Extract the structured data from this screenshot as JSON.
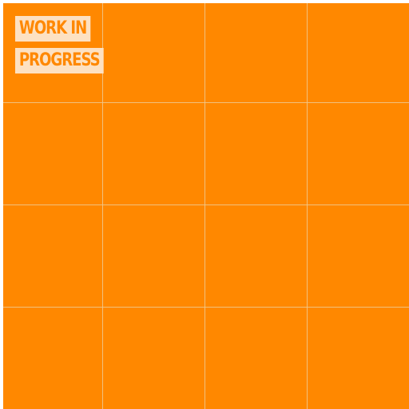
{
  "banner": {
    "line1": "WORK IN",
    "line2": "PROGRESS"
  },
  "colors": {
    "background": "#ff8800",
    "grid_line": "#f0c88c",
    "label_background": "#fde1c2",
    "label_text": "#ff8800"
  },
  "grid": {
    "columns": 4,
    "rows": 4
  }
}
